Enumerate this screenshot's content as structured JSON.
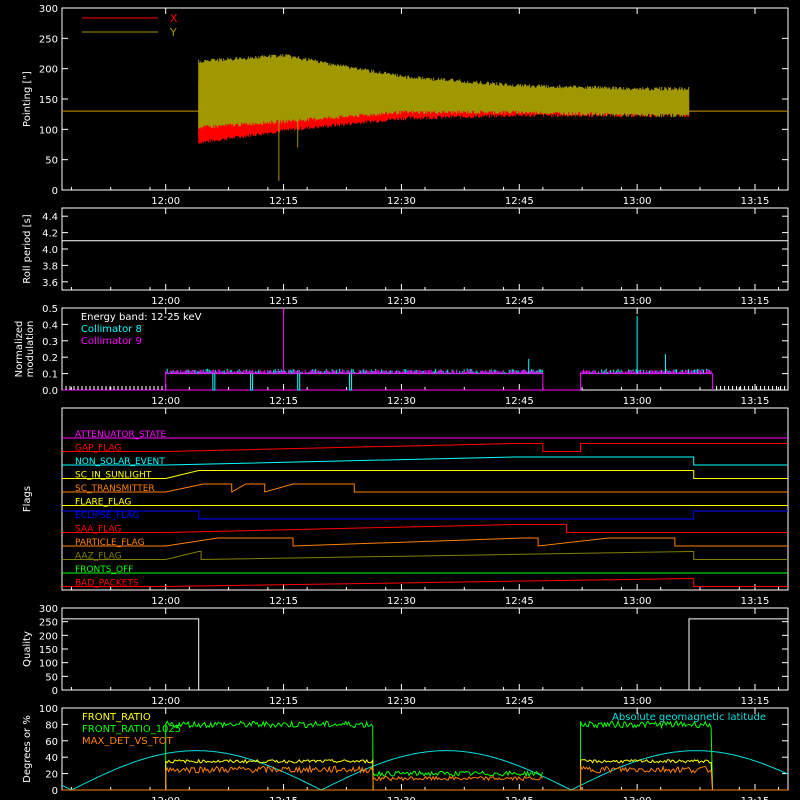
{
  "chart_data": [
    {
      "type": "line",
      "ylabel": "Pointing [\"]",
      "ylim": [
        0,
        300
      ],
      "yticks": [
        "0",
        "50",
        "100",
        "150",
        "200",
        "250",
        "300"
      ],
      "xticks": [
        "12:00",
        "12:15",
        "12:30",
        "12:45",
        "13:00",
        "13:15"
      ],
      "series": [
        {
          "name": "X",
          "color": "#ff0000",
          "baseline": 130,
          "segment": [
            12.07,
            13.11
          ],
          "envelope_t": [
            12.07,
            12.25,
            12.5,
            12.75,
            13.0,
            13.11
          ],
          "envelope_low": [
            75,
            95,
            115,
            120,
            120,
            120
          ],
          "envelope_high": [
            180,
            170,
            160,
            150,
            150,
            150
          ]
        },
        {
          "name": "Y",
          "color": "#a09800",
          "baseline": 130,
          "segment": [
            12.07,
            13.11
          ],
          "envelope_t": [
            12.07,
            12.25,
            12.5,
            12.75,
            13.0,
            13.11
          ],
          "envelope_low": [
            100,
            110,
            125,
            125,
            120,
            120
          ],
          "envelope_high": [
            215,
            225,
            190,
            175,
            170,
            170
          ]
        }
      ]
    },
    {
      "type": "line",
      "ylabel": "Roll period [s]",
      "ylim": [
        3.5,
        4.5
      ],
      "yticks": [
        "3.6",
        "3.8",
        "4.0",
        "4.2",
        "4.4"
      ],
      "xticks": [
        "12:00",
        "12:15",
        "12:30",
        "12:45",
        "13:00",
        "13:15"
      ],
      "series": [
        {
          "color": "#ffffff",
          "value": 4.1
        }
      ]
    },
    {
      "type": "line",
      "ylabel": "Normalized modulation",
      "ylim": [
        0,
        0.5
      ],
      "yticks": [
        "0.0",
        "0.1",
        "0.2",
        "0.3",
        "0.4",
        "0.5"
      ],
      "xticks": [
        "12:00",
        "12:15",
        "12:30",
        "12:45",
        "13:00",
        "13:15"
      ],
      "annotation": "Energy band: 12-25 keV",
      "gaps": [
        [
          12.0,
          12.8
        ],
        [
          12.88,
          13.16
        ]
      ],
      "series": [
        {
          "name": "Collimator 8",
          "color": "#00ffff",
          "level": 0.1
        },
        {
          "name": "Collimator 9",
          "color": "#ff00ff",
          "level": 0.1
        }
      ]
    },
    {
      "type": "line",
      "ylabel": "Flags",
      "xticks": [
        "12:00",
        "12:15",
        "12:30",
        "12:45",
        "13:00",
        "13:15"
      ],
      "flags": [
        {
          "name": "ATTENUATOR_STATE",
          "color": "#ff00ff",
          "transitions": []
        },
        {
          "name": "GAP_FLAG",
          "color": "#ff0000",
          "transitions": [
            [
              12.0,
              0
            ],
            [
              12.74,
              1
            ],
            [
              12.8,
              1
            ],
            [
              12.8,
              0
            ],
            [
              12.88,
              0
            ],
            [
              12.88,
              1
            ],
            [
              12.96,
              1
            ],
            [
              13.16,
              1
            ],
            [
              13.16,
              1
            ]
          ]
        },
        {
          "name": "NON_SOLAR_EVENT",
          "color": "#00ffff",
          "transitions": [
            [
              12.0,
              0
            ],
            [
              12.74,
              1
            ],
            [
              13.12,
              1
            ],
            [
              13.12,
              0
            ]
          ]
        },
        {
          "name": "SC_IN_SUNLIGHT",
          "color": "#ffff00",
          "transitions": [
            [
              12.0,
              0
            ],
            [
              12.07,
              1
            ],
            [
              13.12,
              1
            ],
            [
              13.12,
              0
            ]
          ]
        },
        {
          "name": "SC_TRANSMITTER",
          "color": "#ff8000",
          "transitions": [
            [
              12.0,
              0
            ],
            [
              12.08,
              1
            ],
            [
              12.14,
              1
            ],
            [
              12.14,
              0
            ],
            [
              12.17,
              1
            ],
            [
              12.21,
              1
            ],
            [
              12.21,
              0
            ],
            [
              12.27,
              1
            ],
            [
              12.4,
              1
            ],
            [
              12.4,
              0
            ]
          ]
        },
        {
          "name": "FLARE_FLAG",
          "color": "#ffff00",
          "transitions": []
        },
        {
          "name": "ECLIPSE_FLAG",
          "color": "#0000ff",
          "transitions": [
            [
              12.0,
              1
            ],
            [
              12.07,
              1
            ],
            [
              12.07,
              0
            ],
            [
              13.12,
              0
            ],
            [
              13.12,
              1
            ]
          ]
        },
        {
          "name": "SAA_FLAG",
          "color": "#ff0000",
          "transitions": [
            [
              12.0,
              0
            ],
            [
              12.74,
              1
            ],
            [
              12.85,
              1
            ],
            [
              12.85,
              0
            ]
          ]
        },
        {
          "name": "PARTICLE_FLAG",
          "color": "#ff8000",
          "transitions": [
            [
              12.0,
              0
            ],
            [
              12.11,
              1
            ],
            [
              12.27,
              1
            ],
            [
              12.27,
              0
            ],
            [
              12.76,
              1
            ],
            [
              12.79,
              1
            ],
            [
              12.79,
              0
            ],
            [
              12.94,
              1
            ],
            [
              13.08,
              1
            ],
            [
              13.08,
              0
            ]
          ]
        },
        {
          "name": "AAZ_FLAG",
          "color": "#808000",
          "transitions": [
            [
              12.0,
              0
            ],
            [
              12.07,
              1
            ],
            [
              12.075,
              1
            ],
            [
              12.075,
              0
            ],
            [
              13.115,
              1
            ],
            [
              13.12,
              1
            ],
            [
              13.12,
              0
            ]
          ]
        },
        {
          "name": "FRONTS_OFF",
          "color": "#00ff00",
          "transitions": []
        },
        {
          "name": "BAD_PACKETS",
          "color": "#ff0000",
          "transitions": [
            [
              12.0,
              0
            ],
            [
              13.115,
              1
            ],
            [
              13.12,
              1
            ],
            [
              13.12,
              0
            ]
          ]
        }
      ]
    },
    {
      "type": "line",
      "ylabel": "Quality",
      "ylim": [
        0,
        300
      ],
      "yticks": [
        "0",
        "50",
        "100",
        "150",
        "200",
        "250",
        "300"
      ],
      "xticks": [
        "12:00",
        "12:15",
        "12:30",
        "12:45",
        "13:00",
        "13:15"
      ],
      "series": [
        {
          "color": "#ffffff",
          "points": [
            [
              11.78,
              260
            ],
            [
              12.07,
              260
            ],
            [
              12.07,
              0
            ],
            [
              13.11,
              0
            ],
            [
              13.11,
              260
            ],
            [
              13.32,
              260
            ]
          ]
        }
      ]
    },
    {
      "type": "line",
      "ylabel": "Degrees or %",
      "ylim": [
        0,
        100
      ],
      "yticks": [
        "0",
        "20",
        "40",
        "60",
        "80",
        "100"
      ],
      "xticks": [
        "12:00",
        "12:15",
        "12:30",
        "12:45",
        "13:00",
        "13:15"
      ],
      "annotation": "Absolute geomagnetic latitude",
      "series": [
        {
          "name": "FRONT_RATIO",
          "color": "#ffff00",
          "level": 35
        },
        {
          "name": "FRONT_RATIO_1025",
          "color": "#00ff00",
          "level": 80
        },
        {
          "name": "MAX_DET_VS_TOT",
          "color": "#ff8000",
          "level": 25
        },
        {
          "name": "Absolute geomagnetic latitude",
          "color": "#00e0e0"
        }
      ]
    }
  ]
}
